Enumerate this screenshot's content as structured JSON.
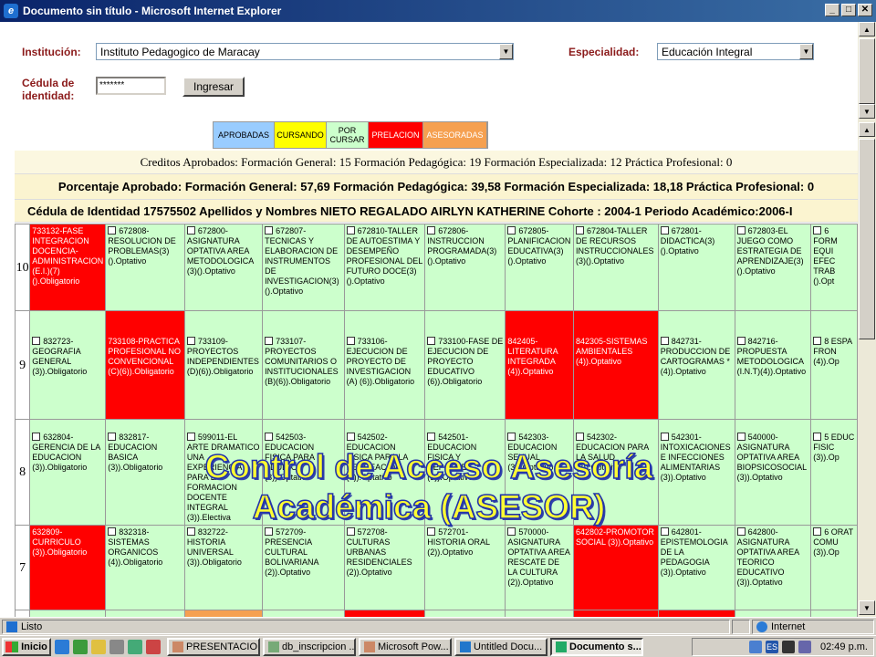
{
  "window": {
    "title": "Documento sin título - Microsoft Internet Explorer",
    "min": "_",
    "max": "□",
    "close": "✕"
  },
  "form": {
    "institucion_label": "Institución:",
    "institucion_value": "Instituto Pedagogico de Maracay",
    "especialidad_label": "Especialidad:",
    "especialidad_value": "Educación Integral",
    "cedula_label": "Cédula de identidad:",
    "cedula_value": "*******",
    "ingresar_label": "Ingresar"
  },
  "legend": [
    {
      "label": "APROBADAS",
      "bg": "#99ccff",
      "fg": "#000"
    },
    {
      "label": "CURSANDO",
      "bg": "#ffff00",
      "fg": "#000"
    },
    {
      "label": "POR CURSAR",
      "bg": "#ccffcc",
      "fg": "#000"
    },
    {
      "label": "PRELACION",
      "bg": "#ff0000",
      "fg": "#fff"
    },
    {
      "label": "ASESORADAS",
      "bg": "#f5a050",
      "fg": "#fff"
    }
  ],
  "info": {
    "creditos": "Creditos Aprobados: Formación General: 15 Formación Pedagógica: 19 Formación Especializada: 12 Práctica Profesional: 0",
    "porcentaje": "Porcentaje Aprobado: Formación General: 57,69 Formación Pedagógica: 39,58 Formación Especializada: 18,18 Práctica Profesional: 0",
    "cedula": "Cédula de Identidad 17575502 Apellidos y Nombres NIETO REGALADO AIRLYN KATHERINE Cohorte : 2004-1 Periodo Académico:2006-I"
  },
  "rows": [
    {
      "sem": "10",
      "cells": [
        {
          "t": "733132-FASE INTEGRACION DOCENCIA-ADMINISTRACION (E.I.)(7) ().Obligatorio",
          "s": "r",
          "cb": false
        },
        {
          "t": "672808-RESOLUCION DE PROBLEMAS(3) ().Optativo",
          "s": "c",
          "cb": true
        },
        {
          "t": "672800-ASIGNATURA OPTATIVA AREA METODOLOGICA (3)().Optativo",
          "s": "c",
          "cb": true
        },
        {
          "t": "672807-TECNICAS Y ELABORACION DE INSTRUMENTOS DE INVESTIGACION(3) ().Optativo",
          "s": "c",
          "cb": true
        },
        {
          "t": "672810-TALLER DE AUTOESTIMA Y DESEMPEÑO PROFESIONAL DEL FUTURO DOCE(3) ().Optativo",
          "s": "c",
          "cb": true
        },
        {
          "t": "672806-INSTRUCCION PROGRAMADA(3) ().Optativo",
          "s": "c",
          "cb": true
        },
        {
          "t": "672805-PLANIFICACION EDUCATIVA(3) ().Optativo",
          "s": "c",
          "cb": true
        },
        {
          "t": "672804-TALLER DE RECURSOS INSTRUCCIONALES (3)().Optativo",
          "s": "c",
          "cb": true
        },
        {
          "t": "672801-DIDACTICA(3) ().Optativo",
          "s": "c",
          "cb": true
        },
        {
          "t": "672803-EL JUEGO COMO ESTRATEGIA DE APRENDIZAJE(3) ().Optativo",
          "s": "c",
          "cb": true
        },
        {
          "t": "6 FORM EQUI EFEC TRAB ().Opt",
          "s": "c",
          "cb": true
        }
      ]
    },
    {
      "sem": "9",
      "cells": [
        {
          "t": "832723-GEOGRAFIA GENERAL (3)).Obligatorio",
          "s": "c",
          "cb": true
        },
        {
          "t": "733108-PRACTICA PROFESIONAL NO CONVENCIONAL (C)(6)).Obligatorio",
          "s": "r",
          "cb": false
        },
        {
          "t": "733109-PROYECTOS INDEPENDIENTES (D)(6)).Obligatorio",
          "s": "c",
          "cb": true
        },
        {
          "t": "733107-PROYECTOS COMUNITARIOS O INSTITUCIONALES (B)(6)).Obligatorio",
          "s": "c",
          "cb": true
        },
        {
          "t": "733106-EJECUCION DE PROYECTO DE INVESTIGACION (A) (6)).Obligatorio",
          "s": "c",
          "cb": true
        },
        {
          "t": "733100-FASE DE EJECUCION DE PROYECTO EDUCATIVO (6)).Obligatorio",
          "s": "c",
          "cb": true
        },
        {
          "t": "842405-LITERATURA INTEGRADA (4)).Optativo",
          "s": "r",
          "cb": false
        },
        {
          "t": "842305-SISTEMAS AMBIENTALES (4)).Optativo",
          "s": "r",
          "cb": false
        },
        {
          "t": "842731-PRODUCCION DE CARTOGRAMAS * (4)).Optativo",
          "s": "c",
          "cb": true
        },
        {
          "t": "842716-PROPUESTA METODOLOGICA (I.N.T)(4)).Optativo",
          "s": "c",
          "cb": true
        },
        {
          "t": "8 ESPA FRON (4)).Op",
          "s": "c",
          "cb": true
        }
      ]
    },
    {
      "sem": "8",
      "cells": [
        {
          "t": "632804-GERENCIA DE LA EDUCACION (3)).Obligatorio",
          "s": "c",
          "cb": true
        },
        {
          "t": "832817-EDUCACION BASICA (3)).Obligatorio",
          "s": "c",
          "cb": true
        },
        {
          "t": "599011-EL ARTE DRAMATICO UNA EXPERIENCIA PARA LA FORMACION DOCENTE INTEGRAL (3)).Electiva",
          "s": "c",
          "cb": true
        },
        {
          "t": "542503-EDUCACION FISICA PARA ADULTOS (3)).Optativo",
          "s": "c",
          "cb": true
        },
        {
          "t": "542502-EDUCACION FISICA PARA LA RECREACION (3)).Optativo",
          "s": "c",
          "cb": true
        },
        {
          "t": "542501-EDUCACION FISICA Y DEPORTES (3)).Optativo",
          "s": "c",
          "cb": true
        },
        {
          "t": "542303-EDUCACION SEXUAL (3)).Optativo",
          "s": "c",
          "cb": true
        },
        {
          "t": "542302-EDUCACION PARA LA SALUD (3)).Optativo",
          "s": "c",
          "cb": true
        },
        {
          "t": "542301-INTOXICACIONES E INFECCIONES ALIMENTARIAS (3)).Optativo",
          "s": "c",
          "cb": true
        },
        {
          "t": "540000-ASIGNATURA OPTATIVA AREA BIOPSICOSOCIAL (3)).Optativo",
          "s": "c",
          "cb": true
        },
        {
          "t": "5 EDUC FISIC (3)).Op",
          "s": "c",
          "cb": true
        }
      ]
    },
    {
      "sem": "7",
      "cells": [
        {
          "t": "632809-CURRICULO (3)).Obligatorio",
          "s": "r",
          "cb": false
        },
        {
          "t": "832318-SISTEMAS ORGANICOS (4)).Obligatorio",
          "s": "c",
          "cb": true
        },
        {
          "t": "832722-HISTORIA UNIVERSAL (3)).Obligatorio",
          "s": "c",
          "cb": true
        },
        {
          "t": "572709-PRESENCIA CULTURAL BOLIVARIANA (2)).Optativo",
          "s": "c",
          "cb": true
        },
        {
          "t": "572708-CULTURAS URBANAS RESIDENCIALES (2)).Optativo",
          "s": "c",
          "cb": true
        },
        {
          "t": "572701-HISTORIA ORAL (2)).Optativo",
          "s": "c",
          "cb": true
        },
        {
          "t": "570000-ASIGNATURA OPTATIVA AREA RESCATE DE LA CULTURA (2)).Optativo",
          "s": "c",
          "cb": true
        },
        {
          "t": "642802-PROMOTOR SOCIAL (3)).Optativo",
          "s": "r",
          "cb": false
        },
        {
          "t": "642801-EPISTEMOLOGIA DE LA PEDAGOGIA (3)).Optativo",
          "s": "c",
          "cb": true
        },
        {
          "t": "642800-ASIGNATURA OPTATIVA AREA TEORICO EDUCATIVO (3)).Optativo",
          "s": "c",
          "cb": true
        },
        {
          "t": "6 ORAT COMU (3)).Op",
          "s": "c",
          "cb": true
        }
      ]
    },
    {
      "sem": "",
      "cells": [
        {
          "t": "",
          "s": "c",
          "cb": false
        },
        {
          "t": "",
          "s": "c",
          "cb": false
        },
        {
          "t": "",
          "s": "o",
          "cb": false
        },
        {
          "t": "",
          "s": "c",
          "cb": false
        },
        {
          "t": "",
          "s": "r",
          "cb": false
        },
        {
          "t": "",
          "s": "c",
          "cb": false
        },
        {
          "t": "",
          "s": "c",
          "cb": false
        },
        {
          "t": "",
          "s": "r",
          "cb": false
        },
        {
          "t": "",
          "s": "r",
          "cb": false
        },
        {
          "t": "",
          "s": "c",
          "cb": false
        },
        {
          "t": "",
          "s": "c",
          "cb": false
        }
      ]
    }
  ],
  "overlay": {
    "line1": "Control de Acceso Asesoría",
    "line2": "Académica (ASESOR)"
  },
  "status": {
    "left": "Listo",
    "zone": "Internet"
  },
  "taskbar": {
    "start": "Inicio",
    "tasks": [
      "PRESENTACIO...",
      "db_inscripcion ...",
      "Microsoft Pow...",
      "Untitled Docu...",
      "Documento s..."
    ],
    "lang": "ES",
    "clock": "02:49 p.m."
  }
}
